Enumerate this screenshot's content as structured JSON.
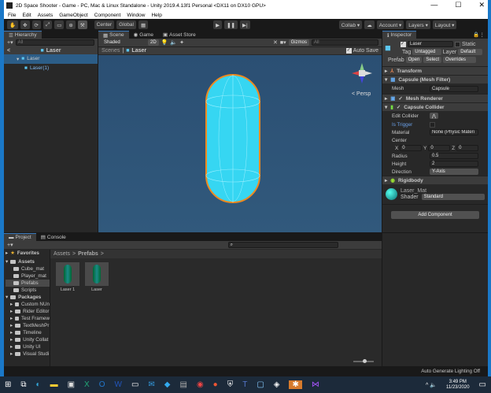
{
  "window": {
    "title": "2D Space Shooter - Game - PC, Mac & Linux Standalone - Unity 2019.4.13f1 Personal <DX11 on DX10 GPU>",
    "controls": [
      "—",
      "☐",
      "✕"
    ]
  },
  "menu": [
    "File",
    "Edit",
    "Assets",
    "GameObject",
    "Component",
    "Window",
    "Help"
  ],
  "toolbar": {
    "tools": [
      "✋",
      "✥",
      "⟳",
      "⤢",
      "▭",
      "⊕",
      "⚒"
    ],
    "pivot": "Center",
    "space": "Global",
    "play": "▶",
    "pause": "❚❚",
    "step": "▶|",
    "collab": "Collab ▾",
    "account": "Account ▾",
    "layers": "Layers ▾",
    "layout": "Layout ▾"
  },
  "hierarchy": {
    "tab": "Hierarchy",
    "search_placeholder": "All",
    "header": "Laser",
    "items": [
      "Laser",
      "Laser(1)"
    ]
  },
  "scene": {
    "tabs": [
      "Scene",
      "Game",
      "Asset Store"
    ],
    "shading": "Shaded",
    "mode2d": "2D",
    "gizmos": "Gizmos",
    "search_placeholder": "All",
    "breadcrumb": [
      "Scenes",
      "Laser"
    ],
    "auto_save": "Auto Save",
    "persp": "< Persp",
    "colors": {
      "bg": "#2f5374",
      "capsule": "#36d6f2",
      "outline": "#f08a1e"
    }
  },
  "inspector": {
    "tab": "Inspector",
    "name": "Laser",
    "static": "Static",
    "tag_label": "Tag",
    "tag": "Untagged",
    "layer_label": "Layer",
    "layer": "Default",
    "prefab_label": "Prefab",
    "open": "Open",
    "select": "Select",
    "overrides": "Overrides",
    "components": {
      "transform": "Transform",
      "mesh_filter": "Capsule (Mesh Filter)",
      "mesh_label": "Mesh",
      "mesh": "Capsule",
      "mesh_renderer": "Mesh Renderer",
      "capsule_collider": "Capsule Collider",
      "rigidbody": "Rigidbody"
    },
    "collider": {
      "edit": "Edit Collider",
      "is_trigger": "Is Trigger",
      "material_label": "Material",
      "material": "None (Physic Materi",
      "center_label": "Center",
      "x_label": "X",
      "x": "0",
      "y_label": "Y",
      "y": "0",
      "z_label": "Z",
      "z": "0",
      "radius_label": "Radius",
      "radius": "0.5",
      "height_label": "Height",
      "height": "2",
      "direction_label": "Direction",
      "direction": "Y-Axis"
    },
    "material": {
      "name": "Laser_Mat",
      "shader_label": "Shader",
      "shader": "Standard"
    },
    "add_component": "Add Component"
  },
  "project": {
    "tabs": [
      "Project",
      "Console"
    ],
    "favorites": "Favorites",
    "assets": "Assets",
    "asset_folders": [
      "Cube_mat",
      "Player_mat",
      "Prefabs",
      "Scripts"
    ],
    "packages": "Packages",
    "package_folders": [
      "Custom NUn",
      "Rider Editor",
      "Test Framew",
      "TextMeshPr",
      "Timeline",
      "Unity Collat",
      "Unity UI",
      "Visual Studi"
    ],
    "breadcrumb": [
      "Assets",
      "Prefabs"
    ],
    "files": [
      "Laser 1",
      "Laser"
    ]
  },
  "status": {
    "text": "Auto Generate Lighting Off"
  },
  "taskbar": {
    "time": "3:49 PM",
    "date": "11/23/2020"
  }
}
